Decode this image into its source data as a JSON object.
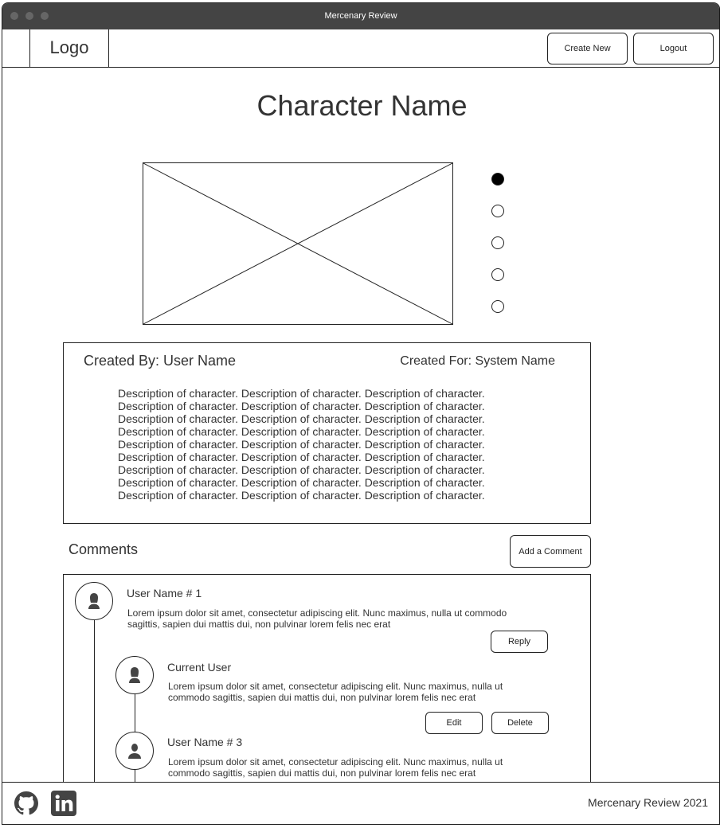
{
  "window": {
    "title": "Mercenary Review"
  },
  "navbar": {
    "logo": "Logo",
    "create_new_label": "Create New",
    "logout_label": "Logout"
  },
  "character": {
    "name": "Character Name",
    "image_placeholder": "image-placeholder",
    "carousel": {
      "total": 5,
      "active_index": 0
    },
    "created_by": "Created By: User Name",
    "created_for": "Created For: System Name",
    "description_lines": [
      "Description of character. Description of character. Description of character.",
      "Description of character. Description of character. Description of character.",
      "Description of character. Description of character. Description of character.",
      "Description of character. Description of character. Description of character.",
      "Description of character. Description of character. Description of character.",
      "Description of character. Description of character. Description of character.",
      "Description of character. Description of character. Description of character.",
      "Description of character. Description of character. Description of character.",
      "Description of character. Description of character. Description of character."
    ]
  },
  "comments": {
    "title": "Comments",
    "add_label": "Add a Comment",
    "items": [
      {
        "user": "User Name # 1",
        "avatar_icon": "user-female-icon",
        "text_line1": "Lorem ipsum dolor sit amet, consectetur adipiscing elit. Nunc maximus, nulla ut commodo",
        "text_line2": "sagittis, sapien dui mattis dui, non pulvinar lorem felis nec erat",
        "reply_label": "Reply"
      },
      {
        "user": "Current User",
        "avatar_icon": "user-female-icon",
        "text_line1": "Lorem ipsum dolor sit amet, consectetur adipiscing elit. Nunc maximus, nulla ut",
        "text_line2": "commodo sagittis, sapien dui mattis dui, non pulvinar lorem felis nec erat",
        "edit_label": "Edit",
        "delete_label": "Delete"
      },
      {
        "user": "User Name # 3",
        "avatar_icon": "user-male-icon",
        "text_line1": "Lorem ipsum dolor sit amet, consectetur adipiscing elit. Nunc maximus, nulla ut",
        "text_line2": "commodo sagittis, sapien dui mattis dui, non pulvinar lorem felis nec erat"
      }
    ]
  },
  "footer": {
    "github_icon": "github-icon",
    "linkedin_icon": "linkedin-icon",
    "copyright": "Mercenary Review 2021"
  },
  "colors": {
    "titlebar": "#444444",
    "border": "#222222",
    "text": "#333333",
    "active_dot": "#000000"
  }
}
